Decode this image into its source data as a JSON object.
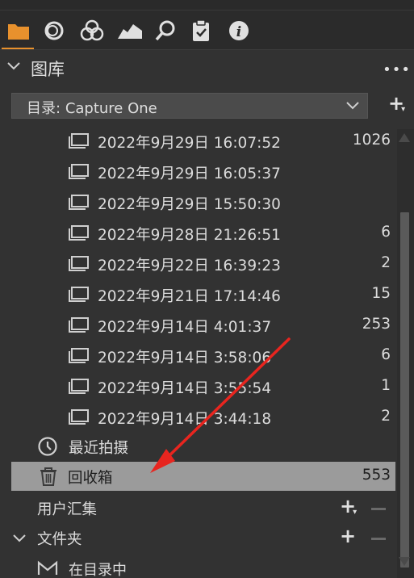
{
  "toolbar": {
    "tabs": [
      "folder-icon",
      "circle-icon",
      "color-icon",
      "mountain-icon",
      "search-icon",
      "clipboard-icon",
      "info-icon"
    ],
    "active_color": "#e8912d"
  },
  "library": {
    "title": "图库",
    "catalog_label": "目录:",
    "catalog_value": "Capture One"
  },
  "imports": [
    {
      "label": "2022年9月29日 16:07:52",
      "count": "1026"
    },
    {
      "label": "2022年9月29日 16:05:37",
      "count": ""
    },
    {
      "label": "2022年9月29日 15:50:30",
      "count": ""
    },
    {
      "label": "2022年9月28日 21:26:51",
      "count": "6"
    },
    {
      "label": "2022年9月22日 16:39:23",
      "count": "2"
    },
    {
      "label": "2022年9月21日 17:14:46",
      "count": "15"
    },
    {
      "label": "2022年9月14日 4:01:37",
      "count": "253"
    },
    {
      "label": "2022年9月14日 3:58:06",
      "count": "6"
    },
    {
      "label": "2022年9月14日 3:55:54",
      "count": "1"
    },
    {
      "label": "2022年9月14日 3:44:18",
      "count": "2"
    }
  ],
  "recent": {
    "label": "最近拍摄"
  },
  "trash": {
    "label": "回收箱",
    "count": "553"
  },
  "user_collections": {
    "label": "用户汇集"
  },
  "folders": {
    "label": "文件夹"
  },
  "in_catalog": {
    "label": "在目录中"
  },
  "annotation_color": "#e8251f"
}
